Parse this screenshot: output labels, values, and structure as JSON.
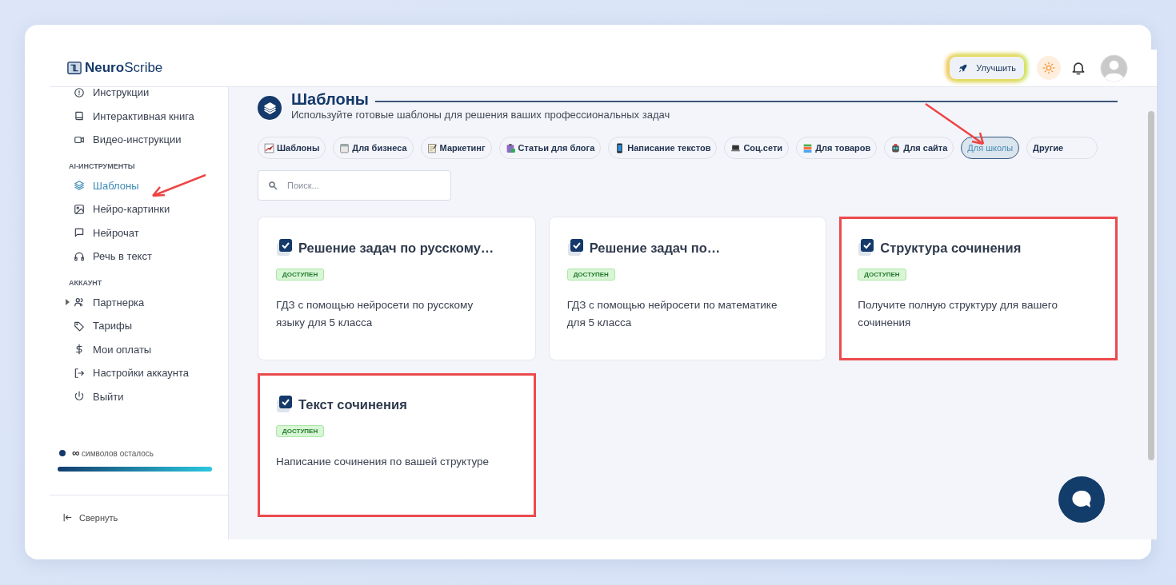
{
  "app": {
    "logo_bold": "Neuro",
    "logo_rest": "Scribe"
  },
  "header": {
    "upgrade_button": "Улучшить"
  },
  "sidebar": {
    "sections": [
      {
        "items": [
          {
            "label": "Инструкции",
            "kind": "link",
            "selected": false
          },
          {
            "label": "Интерактивная книга",
            "kind": "link",
            "selected": false
          },
          {
            "label": "Видео-инструкции",
            "kind": "link",
            "selected": false
          }
        ]
      },
      {
        "title": "AI-ИНСТРУМЕНТЫ",
        "items": [
          {
            "label": "Шаблоны",
            "kind": "link",
            "selected": true
          },
          {
            "label": "Нейро-картинки",
            "kind": "link",
            "selected": false
          },
          {
            "label": "Нейрочат",
            "kind": "link",
            "selected": false
          },
          {
            "label": "Речь в текст",
            "kind": "link",
            "selected": false
          }
        ]
      },
      {
        "title": "АККАУНТ",
        "items": [
          {
            "label": "Партнерка",
            "kind": "group",
            "selected": false
          },
          {
            "label": "Тарифы",
            "kind": "link",
            "selected": false
          },
          {
            "label": "Мои оплаты",
            "kind": "link",
            "selected": false
          },
          {
            "label": "Настройки аккаунта",
            "kind": "link",
            "selected": false
          },
          {
            "label": "Выйти",
            "kind": "link",
            "selected": false
          }
        ]
      }
    ],
    "usage": {
      "amount": "∞",
      "label": "символов осталось",
      "level": 1
    },
    "collapse": "Свернуть"
  },
  "page": {
    "title": "Шаблоны",
    "subtitle": "Используйте готовые шаблоны для решения ваших профессиональных задач",
    "categories": [
      {
        "label": "Шаблоны",
        "selected": false
      },
      {
        "label": "Для бизнеса",
        "selected": false
      },
      {
        "label": "Маркетинг",
        "selected": false
      },
      {
        "label": "Статьи для блога",
        "selected": false
      },
      {
        "label": "Написание текстов",
        "selected": false
      },
      {
        "label": "Соц.сети",
        "selected": false
      },
      {
        "label": "Для товаров",
        "selected": false
      },
      {
        "label": "Для сайта",
        "selected": false
      },
      {
        "label": "Для школы",
        "selected": true
      },
      {
        "label": "Другие",
        "selected": false
      }
    ],
    "search": {
      "placeholder": "Поиск..."
    },
    "cards": [
      {
        "title": "Решение задач по русскому…",
        "badge": "ДОСТУПЕН",
        "description": "ГДЗ с помощью нейросети по русскому языку для 5 класса",
        "highlighted": false
      },
      {
        "title": "Решение задач по…",
        "badge": "ДОСТУПЕН",
        "description": "ГДЗ с помощью нейросети по математике для 5 класса",
        "highlighted": false
      },
      {
        "title": "Структура сочинения",
        "badge": "ДОСТУПЕН",
        "description": "Получите полную структуру для вашего сочинения",
        "highlighted": true
      },
      {
        "title": "Текст сочинения",
        "badge": "ДОСТУПЕН",
        "description": "Написание сочинения по вашей структуре",
        "highlighted": true
      }
    ]
  }
}
